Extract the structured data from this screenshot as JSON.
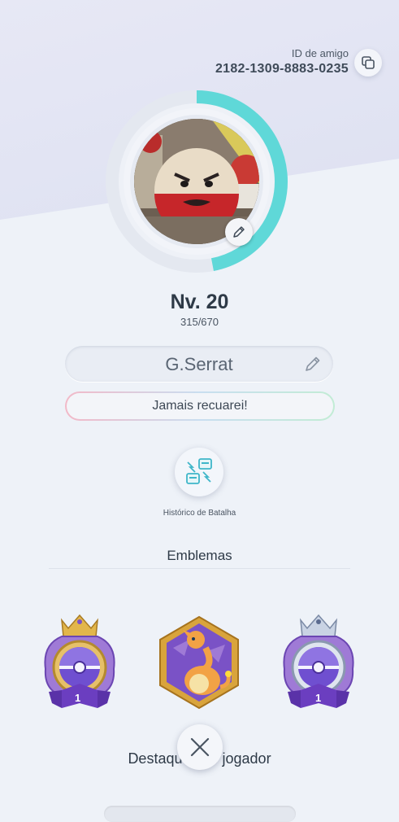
{
  "friend": {
    "label": "ID de amigo",
    "id": "2182-1309-8883-0235"
  },
  "profile": {
    "level_label": "Nv. 20",
    "xp_text": "315/670",
    "xp_progress": 0.47,
    "username": "G.Serrat",
    "motto": "Jamais recuarei!"
  },
  "actions": {
    "battle_history_label": "Histórico de Batalha"
  },
  "emblems": {
    "title": "Emblemas",
    "items": [
      {
        "icon": "gold-crown-pokeball-emblem-icon",
        "rank": "1"
      },
      {
        "icon": "charizard-hexagon-emblem-icon"
      },
      {
        "icon": "silver-crown-pokeball-emblem-icon",
        "rank": "1"
      }
    ]
  },
  "highlights": {
    "title": "Destaques do jogador"
  },
  "colors": {
    "accent_teal": "#5fd8d8",
    "text_dark": "#2e3a47",
    "emblem_purple": "#7b52c8"
  }
}
